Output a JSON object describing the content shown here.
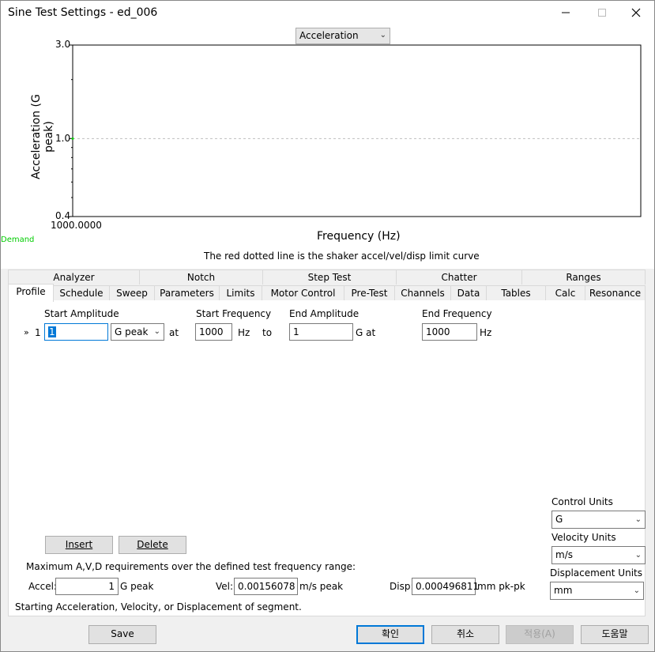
{
  "window": {
    "title": "Sine Test Settings - ed_006"
  },
  "titlebar_icons": {
    "minimize": "minimize-icon",
    "maximize": "maximize-icon",
    "close": "close-icon"
  },
  "chart_selector": {
    "value": "Acceleration"
  },
  "chart_data": {
    "type": "line",
    "title": "",
    "xlabel": "Frequency (Hz)",
    "ylabel": "Acceleration (G peak)",
    "ylim": [
      0.4,
      3.0
    ],
    "yscale": "log",
    "y_ticks": [
      "3.0",
      "1.0",
      "0.4"
    ],
    "x_ticks": [
      "1000.0000"
    ],
    "series": [
      {
        "name": "Demand",
        "color": "#00cc00",
        "x": [
          1000
        ],
        "y": [
          1.0
        ]
      }
    ],
    "reference_line": {
      "y": 1.0,
      "style": "dashed",
      "color": "#c0c0c0"
    },
    "grid": false
  },
  "chart": {
    "y_tick_top": "3.0",
    "y_tick_mid": "1.0",
    "y_tick_bottom": "0.4",
    "x_tick": "1000.0000",
    "y_label": "Acceleration (G peak)",
    "x_label": "Frequency (Hz)",
    "legend_demand": "Demand",
    "note": "The red dotted line is the shaker accel/vel/disp limit curve"
  },
  "tabs_top": [
    "Analyzer",
    "Notch",
    "Step Test",
    "Chatter",
    "Ranges"
  ],
  "tabs_bottom": [
    "Profile",
    "Schedule",
    "Sweep",
    "Parameters",
    "Limits",
    "Motor Control",
    "Pre-Test",
    "Channels",
    "Data",
    "Tables",
    "Calc",
    "Resonance"
  ],
  "profile": {
    "headers": {
      "start_amplitude": "Start Amplitude",
      "start_frequency": "Start Frequency",
      "end_amplitude": "End Amplitude",
      "end_frequency": "End Frequency"
    },
    "row": {
      "marker": "»",
      "index": "1",
      "start_amplitude": "1",
      "amp_unit": "G peak",
      "at1": "at",
      "start_frequency": "1000",
      "hz1": "Hz",
      "to": "to",
      "end_amplitude": "1",
      "g_at": "G at",
      "end_frequency": "1000",
      "hz2": "Hz"
    },
    "insert_label": "Insert",
    "delete_label": "Delete",
    "max_req_text": "Maximum A,V,D requirements over the defined test frequency range:",
    "accel_label": "Accel:",
    "accel_value": "1",
    "accel_unit": "G peak",
    "vel_label": "Vel:",
    "vel_value": "0.00156078",
    "vel_unit": "m/s peak",
    "disp_label": "Disp:",
    "disp_value": "0.000496811",
    "disp_unit": "mm pk-pk",
    "status_text": "Starting Acceleration, Velocity, or Displacement of segment."
  },
  "units": {
    "control_label": "Control Units",
    "control_value": "G",
    "velocity_label": "Velocity Units",
    "velocity_value": "m/s",
    "displacement_label": "Displacement Units",
    "displacement_value": "mm"
  },
  "footer": {
    "save": "Save",
    "ok": "확인",
    "cancel": "취소",
    "apply": "적용(A)",
    "help": "도움말"
  }
}
